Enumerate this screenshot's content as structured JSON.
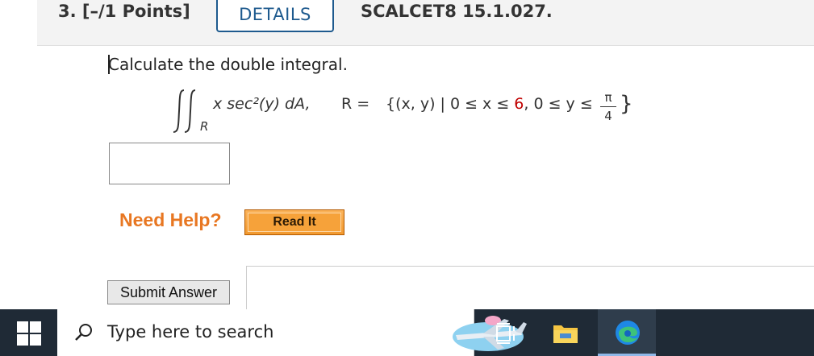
{
  "question": {
    "number": "3.",
    "points": "[–/1 Points]",
    "details_label": "DETAILS",
    "course_code": "SCALCET8 15.1.027."
  },
  "problem": {
    "prompt": "Calculate the double integral.",
    "integral_symbol": "∬",
    "region_subscript": "R",
    "integrand": "x sec²(y) dA,",
    "region_label": "R =",
    "set_open": "{(x, y) | 0 ≤ x ≤ ",
    "x_upper": "6",
    "set_mid": ", 0 ≤ y ≤ ",
    "frac_num": "π",
    "frac_den": "4",
    "set_close": "}"
  },
  "answer": {
    "value": ""
  },
  "help": {
    "need_help": "Need Help?",
    "read_it": "Read It"
  },
  "submit": {
    "label": "Submit Answer"
  },
  "taskbar": {
    "search_placeholder": "Type here to search"
  },
  "colors": {
    "accent_blue": "#1e5a8e",
    "help_orange": "#e87722",
    "highlight_red": "#c00000",
    "taskbar_bg": "#1f2a36"
  }
}
